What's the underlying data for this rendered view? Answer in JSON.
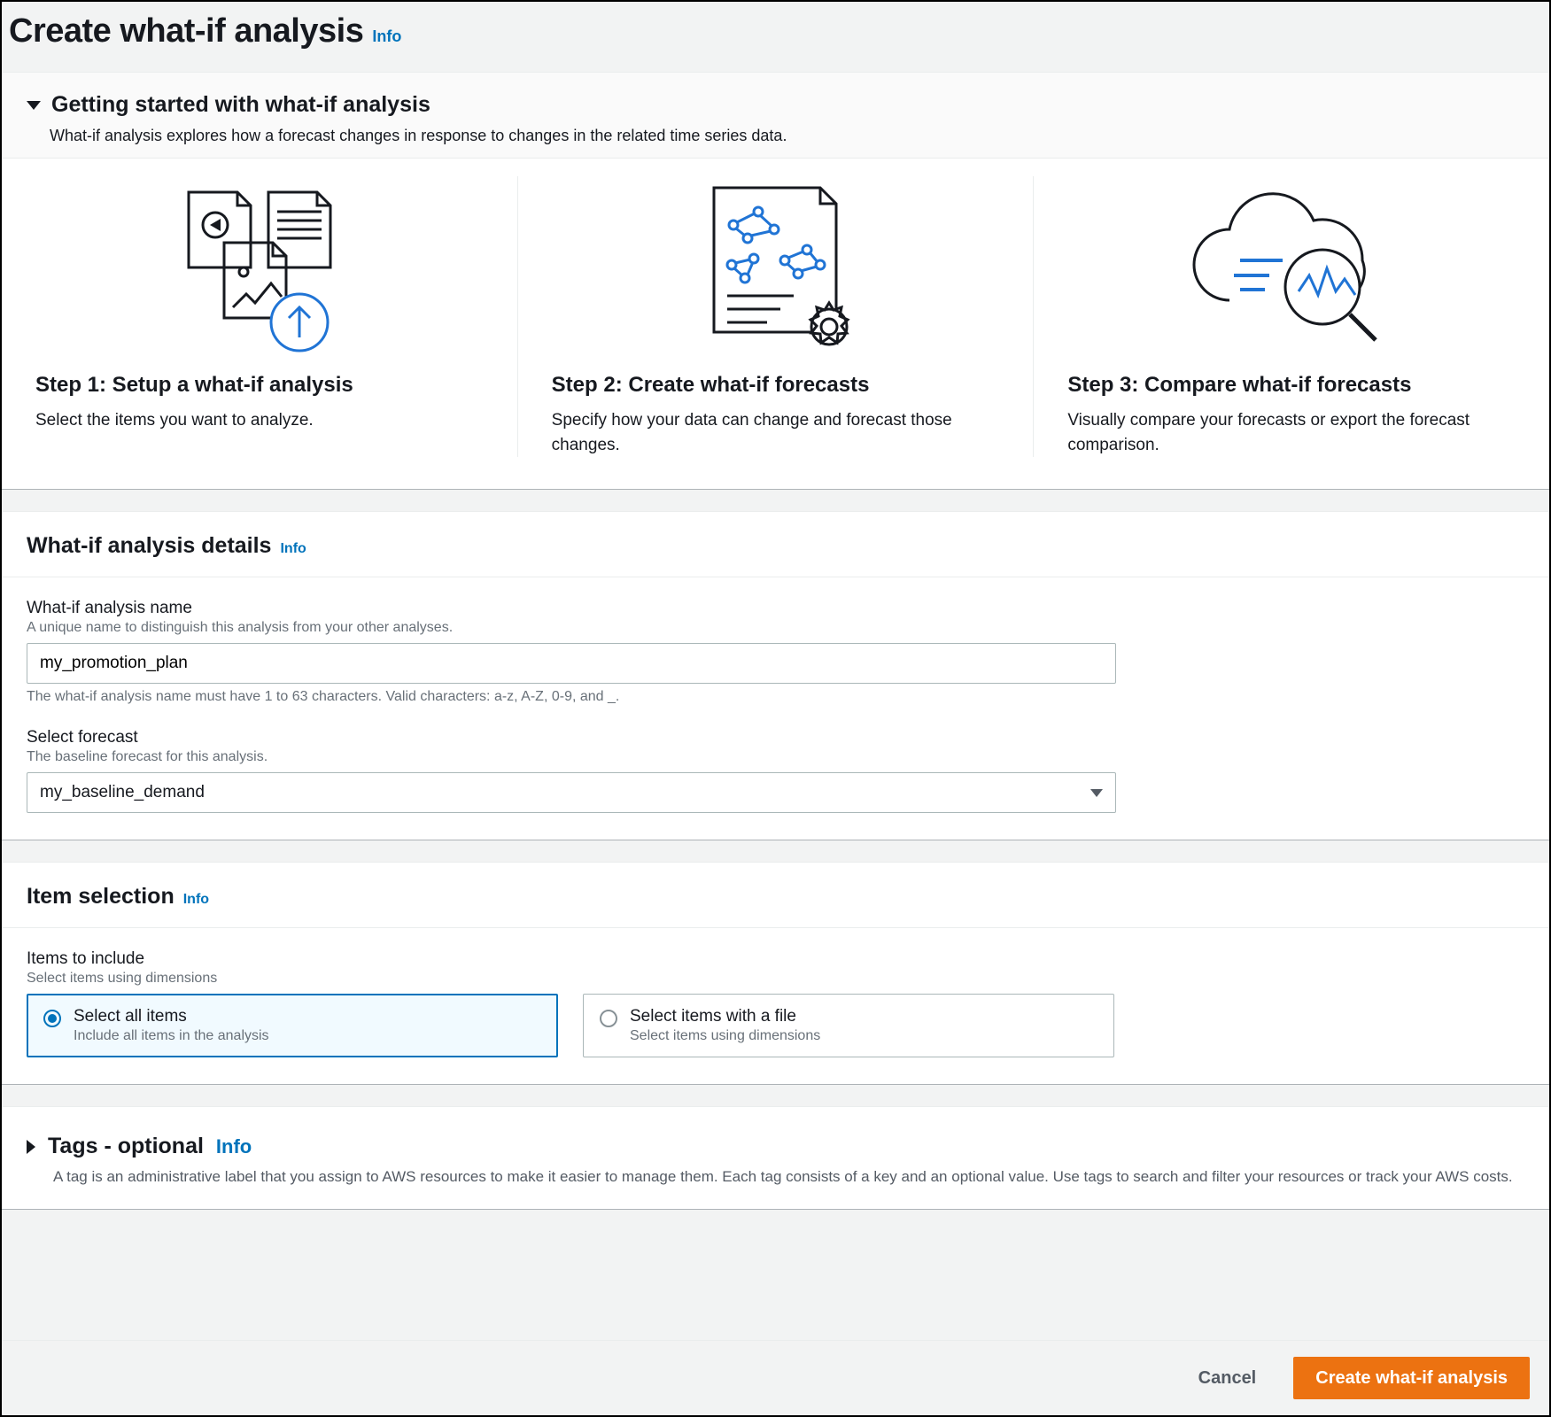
{
  "header": {
    "title": "Create what-if analysis",
    "info": "Info"
  },
  "gettingStarted": {
    "title": "Getting started with what-if analysis",
    "subtext": "What-if analysis explores how a forecast changes in response to changes in the related time series data.",
    "steps": [
      {
        "title": "Step 1: Setup a what-if analysis",
        "desc": "Select the items you want to analyze."
      },
      {
        "title": "Step 2: Create what-if forecasts",
        "desc": "Specify how your data can change and forecast those changes."
      },
      {
        "title": "Step 3: Compare what-if forecasts",
        "desc": "Visually compare your forecasts or export the forecast comparison."
      }
    ]
  },
  "details": {
    "title": "What-if analysis details",
    "info": "Info",
    "nameField": {
      "label": "What-if analysis name",
      "hint": "A unique name to distinguish this analysis from your other analyses.",
      "value": "my_promotion_plan",
      "constraint": "The what-if analysis name must have 1 to 63 characters. Valid characters: a-z, A-Z, 0-9, and _."
    },
    "forecastField": {
      "label": "Select forecast",
      "hint": "The baseline forecast for this analysis.",
      "value": "my_baseline_demand"
    }
  },
  "itemSelection": {
    "title": "Item selection",
    "info": "Info",
    "label": "Items to include",
    "hint": "Select items using dimensions",
    "options": [
      {
        "title": "Select all items",
        "desc": "Include all items in the analysis",
        "selected": true
      },
      {
        "title": "Select items with a file",
        "desc": "Select items using dimensions",
        "selected": false
      }
    ]
  },
  "tags": {
    "title": "Tags - optional",
    "info": "Info",
    "desc": "A tag is an administrative label that you assign to AWS resources to make it easier to manage them. Each tag consists of a key and an optional value. Use tags to search and filter your resources or track your AWS costs."
  },
  "footer": {
    "cancel": "Cancel",
    "submit": "Create what-if analysis"
  }
}
